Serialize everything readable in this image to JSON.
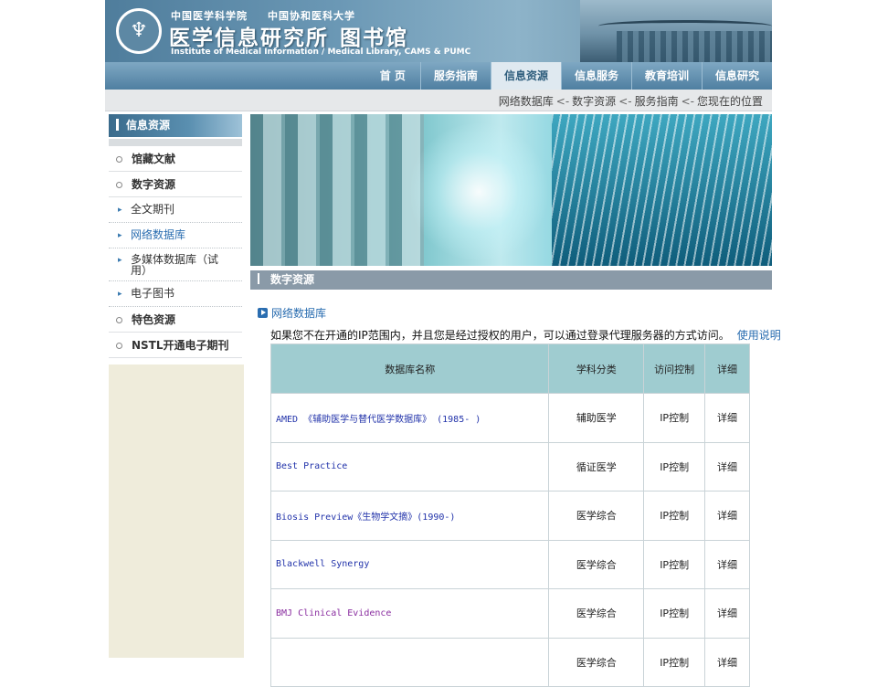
{
  "header": {
    "org_line1_a": "中国医学科学院",
    "org_line1_b": "中国协和医科大学",
    "title_institute": "医学信息研究所",
    "title_library": "图书馆",
    "subtitle": "Institute of Medical Information / Medical Library, CAMS & PUMC",
    "logo_glyph": "♆"
  },
  "nav": {
    "items": [
      "首 页",
      "服务指南",
      "信息资源",
      "信息服务",
      "教育培训",
      "信息研究"
    ],
    "active_index": 2
  },
  "breadcrumb": {
    "parts": [
      "网络数据库",
      "数字资源",
      "服务指南",
      "您现在的位置"
    ],
    "separator": "<-"
  },
  "sidebar": {
    "title": "信息资源",
    "items": [
      {
        "label": "馆藏文献",
        "level": "main"
      },
      {
        "label": "数字资源",
        "level": "main"
      },
      {
        "label": "全文期刊",
        "level": "sub"
      },
      {
        "label": "网络数据库",
        "level": "sub",
        "active": true
      },
      {
        "label": "多媒体数据库（试用）",
        "level": "sub"
      },
      {
        "label": "电子图书",
        "level": "sub"
      },
      {
        "label": "特色资源",
        "level": "main"
      },
      {
        "label": "NSTL开通电子期刊",
        "level": "main"
      }
    ]
  },
  "section": {
    "title": "数字资源",
    "subsection": "网络数据库",
    "notice": "如果您不在开通的IP范围内，并且您是经过授权的用户，可以通过登录代理服务器的方式访问。",
    "help_link": "使用说明"
  },
  "table": {
    "headers": [
      "数据库名称",
      "学科分类",
      "访问控制",
      "详细"
    ],
    "rows": [
      {
        "name": "AMED 《辅助医学与替代医学数据库》 (1985- )",
        "subject": "辅助医学",
        "access": "IP控制",
        "detail": "详细",
        "visited": false
      },
      {
        "name": "Best Practice",
        "subject": "循证医学",
        "access": "IP控制",
        "detail": "详细",
        "visited": false
      },
      {
        "name": "Biosis Preview《生物学文摘》(1990-)",
        "subject": "医学综合",
        "access": "IP控制",
        "detail": "详细",
        "visited": false
      },
      {
        "name": "Blackwell Synergy",
        "subject": "医学综合",
        "access": "IP控制",
        "detail": "详细",
        "visited": false
      },
      {
        "name": "BMJ Clinical Evidence",
        "subject": "医学综合",
        "access": "IP控制",
        "detail": "详细",
        "visited": true
      },
      {
        "name": "",
        "subject": "医学综合",
        "access": "IP控制",
        "detail": "详细",
        "visited": false
      }
    ]
  },
  "colors": {
    "nav_active_text": "#2f5e7d",
    "link": "#2233aa",
    "visited_link": "#8a2ea0",
    "table_header": "#9fccd0",
    "sidebar_fill": "#efecdb"
  }
}
